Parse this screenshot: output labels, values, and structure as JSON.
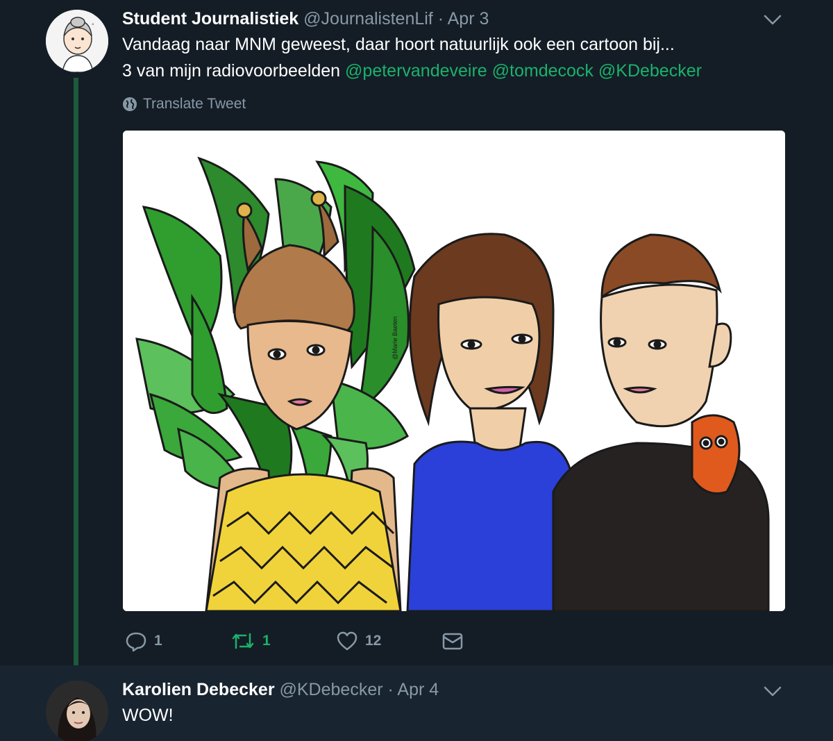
{
  "tweet1": {
    "name": "Student Journalistiek",
    "handle": "@JournalistenLif",
    "separator": "·",
    "date": "Apr 3",
    "line1": "Vandaag naar MNM geweest, daar hoort natuurlijk ook een cartoon bij...",
    "line2_prefix": "3 van mijn radiovoorbeelden",
    "mentions": [
      "@petervandeveire",
      "@tomdecock",
      "@KDebecker"
    ],
    "translate_label": "Translate Tweet",
    "media_watermark": "@Marie Baeten",
    "actions": {
      "reply_count": "1",
      "retweet_count": "1",
      "like_count": "12"
    }
  },
  "tweet2": {
    "name": "Karolien Debecker",
    "handle": "@KDebecker",
    "separator": "·",
    "date": "Apr 4",
    "text": "WOW!"
  },
  "colors": {
    "background": "#141d26",
    "reply_background": "#182430",
    "accent_green": "#1ab26b",
    "muted": "#8899a6",
    "thread_line": "#1d5a3b"
  },
  "icons": [
    "chevron-down-icon",
    "globe-icon",
    "reply-icon",
    "retweet-icon",
    "like-icon",
    "direct-message-icon"
  ]
}
